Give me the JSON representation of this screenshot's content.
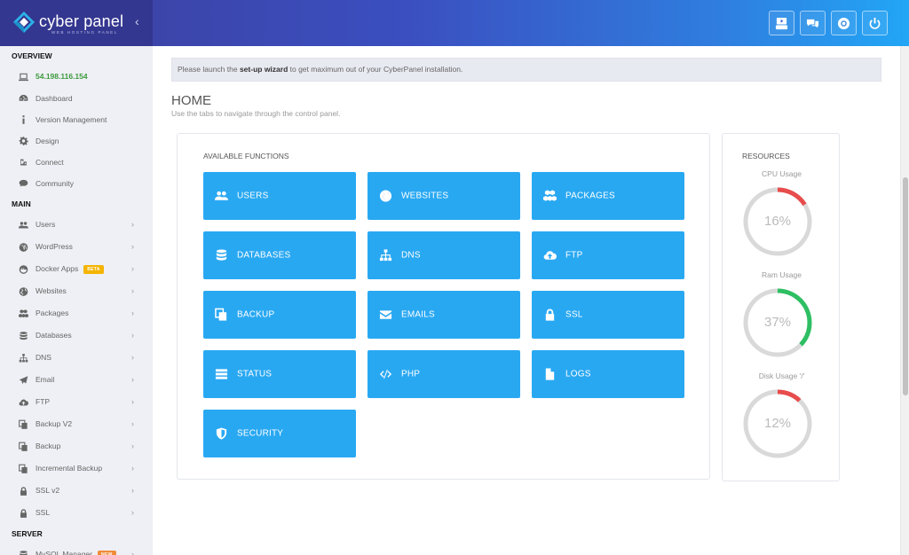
{
  "brand": {
    "name": "cyber panel",
    "tagline": "WEB HOSTING PANEL"
  },
  "header": {
    "buttons": [
      {
        "name": "youtube-icon"
      },
      {
        "name": "chat-icon"
      },
      {
        "name": "support-icon"
      },
      {
        "name": "power-icon"
      }
    ]
  },
  "sidebar": {
    "overview_label": "OVERVIEW",
    "ip": "54.198.116.154",
    "overview_items": [
      {
        "label": "Dashboard",
        "icon": "dashboard-icon"
      },
      {
        "label": "Version Management",
        "icon": "info-icon"
      },
      {
        "label": "Design",
        "icon": "gear-icon"
      },
      {
        "label": "Connect",
        "icon": "link-icon"
      },
      {
        "label": "Community",
        "icon": "comment-icon"
      }
    ],
    "main_label": "MAIN",
    "main_items": [
      {
        "label": "Users",
        "icon": "users-icon"
      },
      {
        "label": "WordPress",
        "icon": "wordpress-icon"
      },
      {
        "label": "Docker Apps",
        "icon": "docker-icon",
        "badge": "BETA"
      },
      {
        "label": "Websites",
        "icon": "globe-icon"
      },
      {
        "label": "Packages",
        "icon": "cubes-icon"
      },
      {
        "label": "Databases",
        "icon": "database-icon"
      },
      {
        "label": "DNS",
        "icon": "sitemap-icon"
      },
      {
        "label": "Email",
        "icon": "paper-plane-icon"
      },
      {
        "label": "FTP",
        "icon": "cloud-upload-icon"
      },
      {
        "label": "Backup V2",
        "icon": "copy-icon"
      },
      {
        "label": "Backup",
        "icon": "copy-icon"
      },
      {
        "label": "Incremental Backup",
        "icon": "copy-icon"
      },
      {
        "label": "SSL v2",
        "icon": "lock-icon"
      },
      {
        "label": "SSL",
        "icon": "lock-icon"
      }
    ],
    "server_label": "SERVER",
    "server_items": [
      {
        "label": "MySQL Manager",
        "icon": "database-icon",
        "badge": "NEW"
      }
    ]
  },
  "notice": {
    "prefix": "Please launch the ",
    "link": "set-up wizard",
    "suffix": " to get maximum out of your CyberPanel installation."
  },
  "page": {
    "title": "HOME",
    "subtitle": "Use the tabs to navigate through the control panel."
  },
  "functions": {
    "title": "AVAILABLE FUNCTIONS",
    "tiles": [
      {
        "label": "USERS",
        "icon": "users-icon"
      },
      {
        "label": "WEBSITES",
        "icon": "globe-icon"
      },
      {
        "label": "PACKAGES",
        "icon": "cubes-icon"
      },
      {
        "label": "DATABASES",
        "icon": "database-icon"
      },
      {
        "label": "DNS",
        "icon": "sitemap-icon"
      },
      {
        "label": "FTP",
        "icon": "cloud-upload-icon"
      },
      {
        "label": "BACKUP",
        "icon": "copy-icon"
      },
      {
        "label": "EMAILS",
        "icon": "envelope-icon"
      },
      {
        "label": "SSL",
        "icon": "lock-icon"
      },
      {
        "label": "STATUS",
        "icon": "server-icon"
      },
      {
        "label": "PHP",
        "icon": "code-icon"
      },
      {
        "label": "LOGS",
        "icon": "file-icon"
      },
      {
        "label": "SECURITY",
        "icon": "shield-icon"
      }
    ]
  },
  "resources": {
    "title": "RESOURCES",
    "gauges": [
      {
        "label": "CPU Usage",
        "value": 16,
        "display": "16%",
        "color": "#e84c4c"
      },
      {
        "label": "Ram Usage",
        "value": 37,
        "display": "37%",
        "color": "#2ebf63"
      },
      {
        "label": "Disk Usage '/'",
        "value": 12,
        "display": "12%",
        "color": "#e84c4c"
      }
    ]
  },
  "colors": {
    "accent": "#29a8f2",
    "gauge_track": "#d9d9d9",
    "ip_green": "#3d9a3d"
  }
}
